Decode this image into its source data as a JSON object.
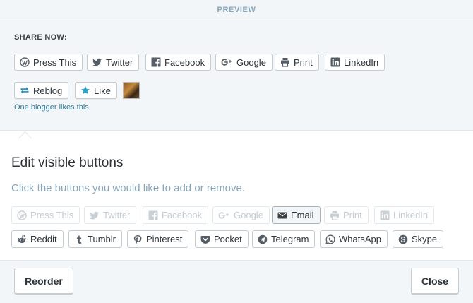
{
  "preview_label": "PREVIEW",
  "share_heading": "SHARE NOW:",
  "share_buttons": [
    {
      "label": "Press This",
      "icon": "wordpress-icon"
    },
    {
      "label": "Twitter",
      "icon": "twitter-icon"
    },
    {
      "label": "Facebook",
      "icon": "facebook-icon"
    },
    {
      "label": "Google",
      "icon": "google-plus-icon"
    },
    {
      "label": "Print",
      "icon": "print-icon"
    },
    {
      "label": "LinkedIn",
      "icon": "linkedin-icon"
    }
  ],
  "reblog_label": "Reblog",
  "like_label": "Like",
  "like_text": "One blogger likes this.",
  "edit": {
    "title": "Edit visible buttons",
    "subtitle": "Click the buttons you would like to add or remove.",
    "row1": [
      {
        "label": "Press This",
        "icon": "wordpress-icon",
        "state": "disabled"
      },
      {
        "label": "Twitter",
        "icon": "twitter-icon",
        "state": "disabled"
      },
      {
        "label": "Facebook",
        "icon": "facebook-icon",
        "state": "disabled"
      },
      {
        "label": "Google",
        "icon": "google-plus-icon",
        "state": "disabled"
      },
      {
        "label": "Email",
        "icon": "email-icon",
        "state": "active"
      },
      {
        "label": "Print",
        "icon": "print-icon",
        "state": "disabled"
      },
      {
        "label": "LinkedIn",
        "icon": "linkedin-icon",
        "state": "disabled"
      }
    ],
    "row2": [
      {
        "label": "Reddit",
        "icon": "reddit-icon"
      },
      {
        "label": "Tumblr",
        "icon": "tumblr-icon"
      },
      {
        "label": "Pinterest",
        "icon": "pinterest-icon"
      },
      {
        "label": "Pocket",
        "icon": "pocket-icon"
      },
      {
        "label": "Telegram",
        "icon": "telegram-icon"
      },
      {
        "label": "WhatsApp",
        "icon": "whatsapp-icon"
      },
      {
        "label": "Skype",
        "icon": "skype-icon"
      }
    ]
  },
  "footer": {
    "reorder_label": "Reorder",
    "close_label": "Close"
  },
  "colors": {
    "accent_text": "#87a6bc",
    "link": "#2d7ba0",
    "reblog_icon": "#1e8cbe",
    "like_icon": "#2ea2cc"
  }
}
